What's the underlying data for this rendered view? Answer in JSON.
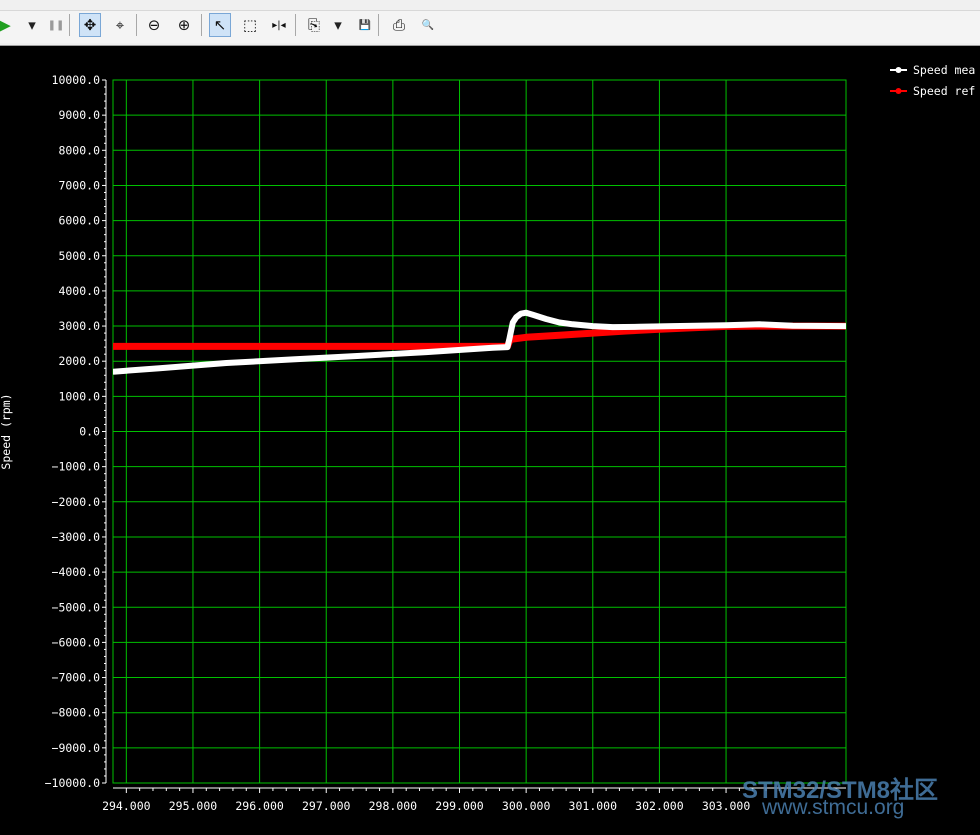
{
  "toolbar": {
    "buttons": [
      {
        "name": "run-button",
        "glyph": "▶",
        "color": "#20a020"
      },
      {
        "name": "run-dropdown-button",
        "glyph": "▾",
        "color": "#222222"
      },
      {
        "name": "pause-button",
        "glyph": "❚❚",
        "color": "#9a9a9a"
      },
      {
        "name": "pan-button",
        "glyph": "✥",
        "color": "#111111",
        "active": true
      },
      {
        "name": "zoom-fit-button",
        "glyph": "⌖",
        "color": "#111111"
      },
      {
        "name": "zoom-out-button",
        "glyph": "⊖",
        "color": "#111111"
      },
      {
        "name": "zoom-in-button",
        "glyph": "⊕",
        "color": "#111111"
      },
      {
        "name": "select-pointer-button",
        "glyph": "↖",
        "color": "#111111",
        "active": true
      },
      {
        "name": "box-select-button",
        "glyph": "⬚",
        "color": "#111111"
      },
      {
        "name": "cursor-measure-button",
        "glyph": "▸|◂",
        "color": "#111111"
      },
      {
        "name": "copy-button",
        "glyph": "⎘",
        "color": "#111111"
      },
      {
        "name": "copy-dropdown-button",
        "glyph": "▾",
        "color": "#222222"
      },
      {
        "name": "save-button",
        "glyph": "💾",
        "color": "#111111"
      },
      {
        "name": "print-button",
        "glyph": "⎙",
        "color": "#111111"
      },
      {
        "name": "print-preview-button",
        "glyph": "🔍",
        "color": "#111111"
      }
    ]
  },
  "watermark": {
    "line1": "STM32/STM8社区",
    "line2": "www.stmcu.org"
  },
  "chart_data": {
    "type": "line",
    "ylabel": "Speed (rpm)",
    "xlabel": "",
    "xlim": [
      293.8,
      304.8
    ],
    "ylim": [
      -10000,
      10000
    ],
    "x_ticks": [
      294,
      295,
      296,
      297,
      298,
      299,
      300,
      301,
      302,
      303
    ],
    "x_tick_labels": [
      "294.000",
      "295.000",
      "296.000",
      "297.000",
      "298.000",
      "299.000",
      "300.000",
      "301.000",
      "302.000",
      "303.000"
    ],
    "y_ticks": [
      10000,
      9000,
      8000,
      7000,
      6000,
      5000,
      4000,
      3000,
      2000,
      1000,
      0,
      -1000,
      -2000,
      -3000,
      -4000,
      -5000,
      -6000,
      -7000,
      -8000,
      -9000,
      -10000
    ],
    "y_tick_labels": [
      "10000.0",
      "9000.0",
      "8000.0",
      "7000.0",
      "6000.0",
      "5000.0",
      "4000.0",
      "3000.0",
      "2000.0",
      "1000.0",
      "0.0",
      "−1000.0",
      "−2000.0",
      "−3000.0",
      "−4000.0",
      "−5000.0",
      "−6000.0",
      "−7000.0",
      "−8000.0",
      "−9000.0",
      "−10000.0"
    ],
    "grid": true,
    "grid_color": "#00c000",
    "background": "#000000",
    "legend_position": "top-right",
    "series": [
      {
        "name": "Speed measured",
        "legend_label": "Speed mea",
        "color": "#ffffff",
        "points": [
          [
            293.8,
            1700
          ],
          [
            294.5,
            1800
          ],
          [
            295.5,
            1950
          ],
          [
            296.5,
            2050
          ],
          [
            297.5,
            2150
          ],
          [
            298.5,
            2260
          ],
          [
            299.5,
            2380
          ],
          [
            299.72,
            2400
          ],
          [
            299.75,
            2650
          ],
          [
            299.8,
            3100
          ],
          [
            299.85,
            3250
          ],
          [
            299.92,
            3350
          ],
          [
            300.0,
            3380
          ],
          [
            300.1,
            3320
          ],
          [
            300.3,
            3200
          ],
          [
            300.5,
            3100
          ],
          [
            300.7,
            3050
          ],
          [
            301.0,
            3000
          ],
          [
            301.3,
            2970
          ],
          [
            301.7,
            2980
          ],
          [
            302.2,
            3000
          ],
          [
            303.0,
            3020
          ],
          [
            303.5,
            3050
          ],
          [
            304.0,
            3010
          ],
          [
            304.8,
            3000
          ]
        ]
      },
      {
        "name": "Speed reference",
        "legend_label": "Speed ref",
        "color": "#ff0000",
        "points": [
          [
            293.8,
            2420
          ],
          [
            294.5,
            2420
          ],
          [
            295.5,
            2420
          ],
          [
            296.5,
            2420
          ],
          [
            297.5,
            2420
          ],
          [
            298.2,
            2420
          ],
          [
            298.5,
            2420
          ],
          [
            299.5,
            2420
          ],
          [
            299.72,
            2420
          ],
          [
            299.76,
            2620
          ],
          [
            300.0,
            2680
          ],
          [
            300.5,
            2740
          ],
          [
            301.0,
            2800
          ],
          [
            301.5,
            2860
          ],
          [
            302.0,
            2910
          ],
          [
            302.5,
            2950
          ],
          [
            303.0,
            2990
          ],
          [
            303.5,
            3000
          ],
          [
            304.8,
            3000
          ]
        ]
      }
    ]
  }
}
